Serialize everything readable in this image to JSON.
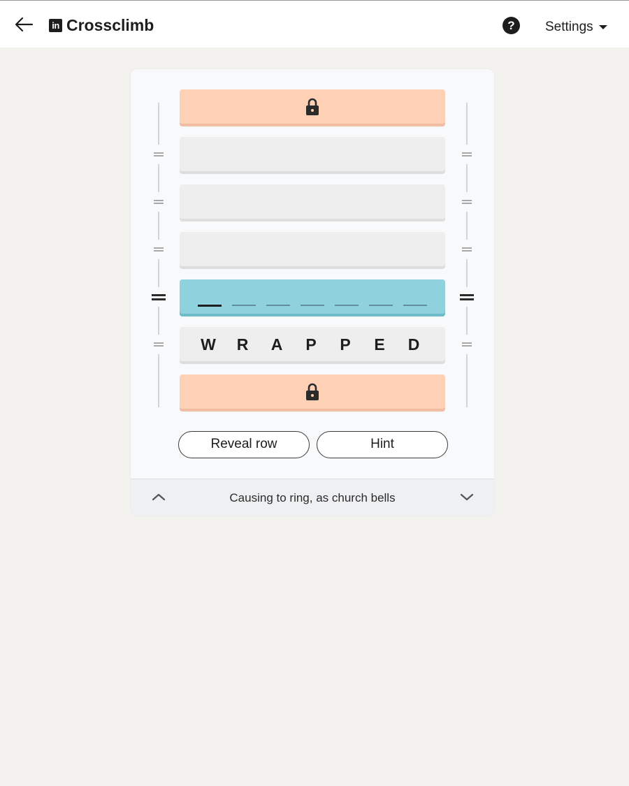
{
  "header": {
    "back_icon": "arrow-left-icon",
    "logo_text": "in",
    "title": "Crossclimb",
    "help_glyph": "?",
    "settings_label": "Settings"
  },
  "puzzle": {
    "rows": [
      {
        "state": "locked",
        "icon": "lock-icon"
      },
      {
        "state": "empty"
      },
      {
        "state": "empty"
      },
      {
        "state": "empty"
      },
      {
        "state": "active",
        "slots": 7,
        "cursor_index": 0
      },
      {
        "state": "word",
        "letters": [
          "W",
          "R",
          "A",
          "P",
          "P",
          "E",
          "D"
        ]
      },
      {
        "state": "locked",
        "icon": "lock-icon"
      }
    ],
    "row_handle_icon": "drag-handle-icon"
  },
  "actions": {
    "reveal_label": "Reveal row",
    "hint_label": "Hint"
  },
  "clue": {
    "text": "Causing to ring, as church bells",
    "prev_icon": "chevron-up-icon",
    "next_icon": "chevron-down-icon"
  },
  "colors": {
    "locked": "#fed1b6",
    "active": "#8fd1dc",
    "empty": "#eeeeee",
    "background": "#f3f2ef"
  }
}
